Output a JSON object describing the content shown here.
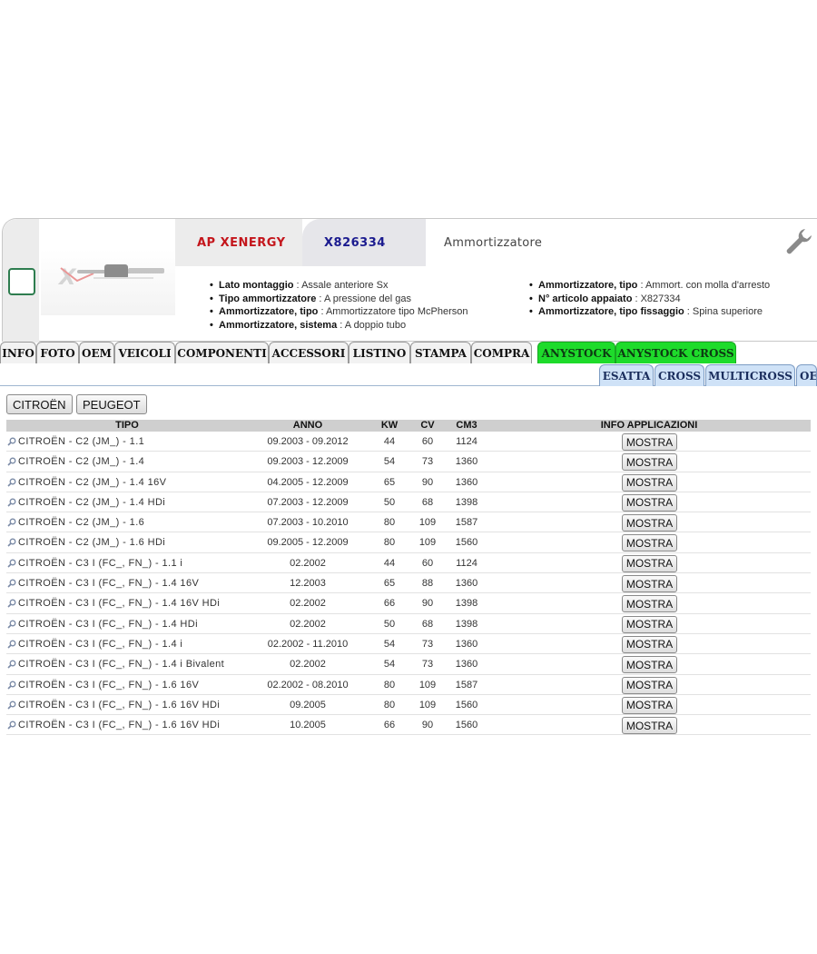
{
  "header": {
    "brand": "AP XENERGY",
    "code": "X826334",
    "description": "Ammortizzatore",
    "specs_left": [
      {
        "label": "Lato montaggio",
        "value": "Assale anteriore Sx"
      },
      {
        "label": "Tipo ammortizzatore",
        "value": "A pressione del gas"
      },
      {
        "label": "Ammortizzatore, tipo",
        "value": "Ammortizzatore tipo McPherson"
      },
      {
        "label": "Ammortizzatore, sistema",
        "value": "A doppio tubo"
      }
    ],
    "specs_right": [
      {
        "label": "Ammortizzatore, tipo",
        "value": "Ammort. con molla d'arresto"
      },
      {
        "label": "N° articolo appaiato",
        "value": "X827334"
      },
      {
        "label": "Ammortizzatore, tipo fissaggio",
        "value": "Spina superiore"
      }
    ],
    "icons": {
      "wrench": "wrench-icon",
      "checkbox": "checkbox"
    }
  },
  "nav_tabs": [
    "INFO",
    "FOTO",
    "OEM",
    "VEICOLI",
    "COMPONENTI",
    "ACCESSORI",
    "LISTINO",
    "STAMPA",
    "COMPRA",
    "ANYSTOCK",
    "ANYSTOCK CROSS"
  ],
  "sub_tabs": [
    "ESATTA",
    "CROSS",
    "MULTICROSS",
    "OE"
  ],
  "brand_buttons": [
    "CITROËN",
    "PEUGEOT"
  ],
  "table": {
    "headers": {
      "tipo": "TIPO",
      "anno": "ANNO",
      "kw": "KW",
      "cv": "CV",
      "cm3": "CM3",
      "info": "INFO APPLICAZIONI"
    },
    "action_label": "MOSTRA",
    "rows": [
      {
        "tipo": "CITROËN - C2 (JM_) - 1.1",
        "anno": "09.2003 - 09.2012",
        "kw": "44",
        "cv": "60",
        "cm3": "1124"
      },
      {
        "tipo": "CITROËN - C2 (JM_) - 1.4",
        "anno": "09.2003 - 12.2009",
        "kw": "54",
        "cv": "73",
        "cm3": "1360"
      },
      {
        "tipo": "CITROËN - C2 (JM_) - 1.4 16V",
        "anno": "04.2005 - 12.2009",
        "kw": "65",
        "cv": "90",
        "cm3": "1360"
      },
      {
        "tipo": "CITROËN - C2 (JM_) - 1.4 HDi",
        "anno": "07.2003 - 12.2009",
        "kw": "50",
        "cv": "68",
        "cm3": "1398"
      },
      {
        "tipo": "CITROËN - C2 (JM_) - 1.6",
        "anno": "07.2003 - 10.2010",
        "kw": "80",
        "cv": "109",
        "cm3": "1587"
      },
      {
        "tipo": "CITROËN - C2 (JM_) - 1.6 HDi",
        "anno": "09.2005 - 12.2009",
        "kw": "80",
        "cv": "109",
        "cm3": "1560"
      },
      {
        "tipo": "CITROËN - C3 I (FC_, FN_) - 1.1 i",
        "anno": "02.2002",
        "kw": "44",
        "cv": "60",
        "cm3": "1124"
      },
      {
        "tipo": "CITROËN - C3 I (FC_, FN_) - 1.4 16V",
        "anno": "12.2003",
        "kw": "65",
        "cv": "88",
        "cm3": "1360"
      },
      {
        "tipo": "CITROËN - C3 I (FC_, FN_) - 1.4 16V HDi",
        "anno": "02.2002",
        "kw": "66",
        "cv": "90",
        "cm3": "1398"
      },
      {
        "tipo": "CITROËN - C3 I (FC_, FN_) - 1.4 HDi",
        "anno": "02.2002",
        "kw": "50",
        "cv": "68",
        "cm3": "1398"
      },
      {
        "tipo": "CITROËN - C3 I (FC_, FN_) - 1.4 i",
        "anno": "02.2002 - 11.2010",
        "kw": "54",
        "cv": "73",
        "cm3": "1360"
      },
      {
        "tipo": "CITROËN - C3 I (FC_, FN_) - 1.4 i Bivalent",
        "anno": "02.2002",
        "kw": "54",
        "cv": "73",
        "cm3": "1360"
      },
      {
        "tipo": "CITROËN - C3 I (FC_, FN_) - 1.6 16V",
        "anno": "02.2002 - 08.2010",
        "kw": "80",
        "cv": "109",
        "cm3": "1587"
      },
      {
        "tipo": "CITROËN - C3 I (FC_, FN_) - 1.6 16V HDi",
        "anno": "09.2005",
        "kw": "80",
        "cv": "109",
        "cm3": "1560"
      },
      {
        "tipo": "CITROËN - C3 I (FC_, FN_) - 1.6 16V HDi",
        "anno": "10.2005",
        "kw": "66",
        "cv": "90",
        "cm3": "1560"
      }
    ]
  },
  "colors": {
    "brand": "#c4161c",
    "code": "#1b1b8f",
    "anystock": "#1edb2b",
    "subtab": "#cfe2f7"
  }
}
